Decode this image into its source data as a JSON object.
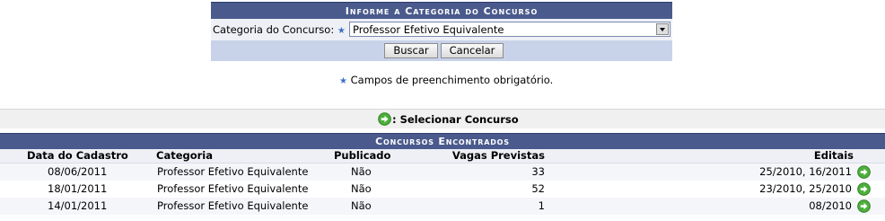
{
  "form": {
    "title": "Informe a Categoria do Concurso",
    "category_label": "Categoria do Concurso:",
    "required_marker": "★",
    "category_value": "Professor Efetivo Equivalente",
    "search_button": "Buscar",
    "cancel_button": "Cancelar"
  },
  "required_note": "Campos de preenchimento obrigatório.",
  "legend": {
    "label": ": Selecionar Concurso",
    "icon": "green-arrow-right-icon"
  },
  "results": {
    "title": "Concursos Encontrados",
    "columns": [
      "Data do Cadastro",
      "Categoria",
      "Publicado",
      "Vagas Previstas",
      "Editais"
    ],
    "rows": [
      {
        "date": "08/06/2011",
        "category": "Professor Efetivo Equivalente",
        "published": "Não",
        "vacancies": "33",
        "notices": "25/2010, 16/2011"
      },
      {
        "date": "18/01/2011",
        "category": "Professor Efetivo Equivalente",
        "published": "Não",
        "vacancies": "52",
        "notices": "23/2010, 25/2010"
      },
      {
        "date": "14/01/2011",
        "category": "Professor Efetivo Equivalente",
        "published": "Não",
        "vacancies": "1",
        "notices": "08/2010"
      }
    ]
  },
  "colors": {
    "header_bg": "#4a5a8c",
    "form_row_bg": "#eef0f6",
    "form_foot_bg": "#c8d3ea",
    "icon_green": "#4caf3a",
    "required_star": "#3d6fc8"
  }
}
